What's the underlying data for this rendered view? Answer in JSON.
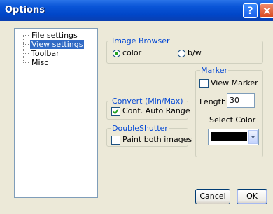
{
  "window": {
    "title": "Options"
  },
  "titlebar": {
    "help_label": "?"
  },
  "tree": {
    "items": [
      {
        "label": "File settings"
      },
      {
        "label": "View settings"
      },
      {
        "label": "Toolbar"
      },
      {
        "label": "Misc"
      }
    ]
  },
  "image_browser": {
    "label": "Image Browser",
    "options": [
      {
        "label": "color",
        "selected": true
      },
      {
        "label": "b/w",
        "selected": false
      }
    ]
  },
  "marker": {
    "label": "Marker",
    "view_marker_label": "View Marker",
    "view_marker_checked": false,
    "length_label": "Length",
    "length_value": "30",
    "select_color_label": "Select Color",
    "color": "#000000"
  },
  "convert": {
    "label": "Convert (Min/Max)",
    "cont_auto_range_label": "Cont. Auto Range",
    "cont_auto_range_checked": true
  },
  "double_shutter": {
    "label": "DoubleShutter",
    "paint_both_label": "Paint both images",
    "paint_both_checked": false
  },
  "buttons": {
    "cancel": "Cancel",
    "ok": "OK"
  }
}
